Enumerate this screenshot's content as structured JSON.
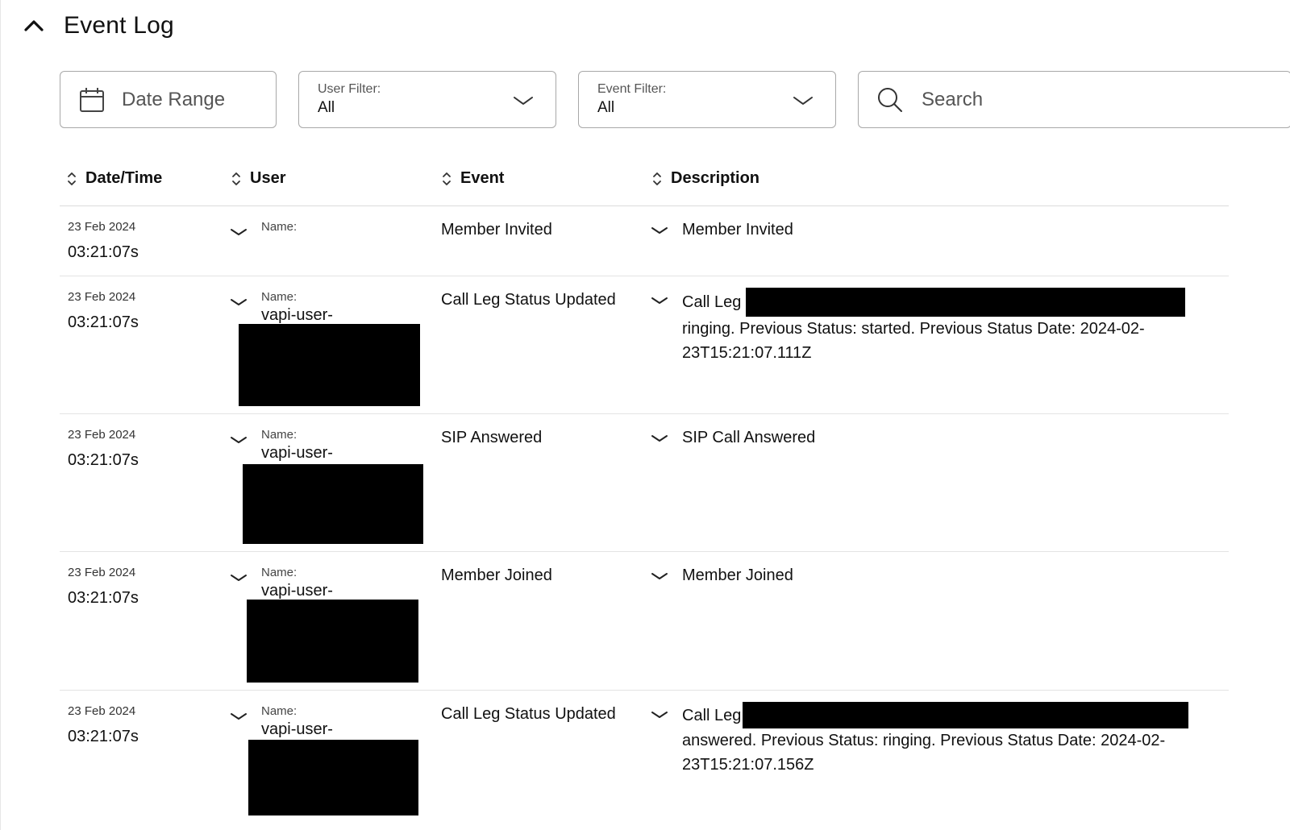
{
  "header": {
    "title": "Event Log"
  },
  "filters": {
    "date_range_placeholder": "Date Range",
    "user_filter": {
      "label": "User Filter:",
      "value": "All"
    },
    "event_filter": {
      "label": "Event Filter:",
      "value": "All"
    },
    "search_placeholder": "Search"
  },
  "table": {
    "columns": [
      "Date/Time",
      "User",
      "Event",
      "Description"
    ],
    "rows": [
      {
        "date": "23 Feb 2024",
        "time": "03:21:07s",
        "name_label": "Name:",
        "user": "",
        "event": "Member Invited",
        "desc_line1": "Member Invited",
        "desc_rest": ""
      },
      {
        "date": "23 Feb 2024",
        "time": "03:21:07s",
        "name_label": "Name:",
        "user": "vapi-user-",
        "event": "Call Leg Status Updated",
        "desc_line1": "Call Leg",
        "desc_rest": "ringing. Previous Status: started. Previous Status Date: 2024-02-23T15:21:07.111Z"
      },
      {
        "date": "23 Feb 2024",
        "time": "03:21:07s",
        "name_label": "Name:",
        "user": "vapi-user-",
        "event": "SIP Answered",
        "desc_line1": "SIP Call Answered",
        "desc_rest": ""
      },
      {
        "date": "23 Feb 2024",
        "time": "03:21:07s",
        "name_label": "Name:",
        "user": "vapi-user-",
        "event": "Member Joined",
        "desc_line1": "Member Joined",
        "desc_rest": ""
      },
      {
        "date": "23 Feb 2024",
        "time": "03:21:07s",
        "name_label": "Name:",
        "user": "vapi-user-",
        "event": "Call Leg Status Updated",
        "desc_line1": "Call Leg",
        "desc_rest": "answered. Previous Status: ringing. Previous Status Date: 2024-02-23T15:21:07.156Z"
      }
    ]
  },
  "icons": {
    "collapse": "chevron-up-icon",
    "calendar": "calendar-icon",
    "dropdown": "chevron-down-icon",
    "search": "search-icon",
    "sort": "sort-icon",
    "expand": "chevron-down-icon"
  },
  "colors": {
    "redaction": "#000000",
    "border": "#a8a8a8",
    "text": "#111111"
  }
}
